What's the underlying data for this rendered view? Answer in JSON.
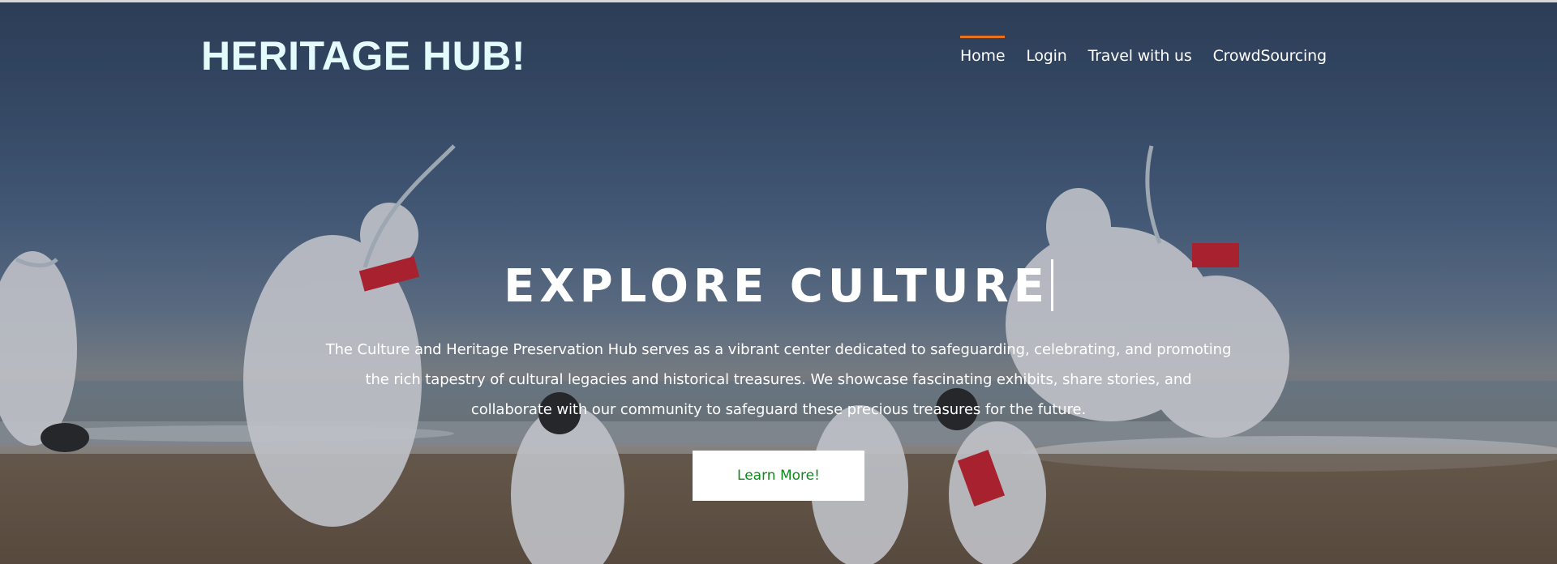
{
  "site": {
    "logo_text": "HERITAGE HUB!"
  },
  "nav": {
    "items": [
      {
        "label": "Home",
        "active": true
      },
      {
        "label": "Login",
        "active": false
      },
      {
        "label": "Travel with us",
        "active": false
      },
      {
        "label": "CrowdSourcing",
        "active": false
      }
    ]
  },
  "hero": {
    "headline": "EXPLORE CULTURE",
    "description": "The Culture and Heritage Preservation Hub serves as a vibrant center dedicated to safeguarding, celebrating, and promoting the rich tapestry of cultural legacies and historical treasures. We showcase fascinating exhibits, share stories, and collaborate with our community to safeguard these precious treasures for the future.",
    "cta_label": "Learn More!"
  },
  "colors": {
    "logo": "#e3fbfd",
    "nav_active_indicator": "#e8731b",
    "cta_text": "#0f8a1b",
    "cta_background": "#ffffff"
  }
}
